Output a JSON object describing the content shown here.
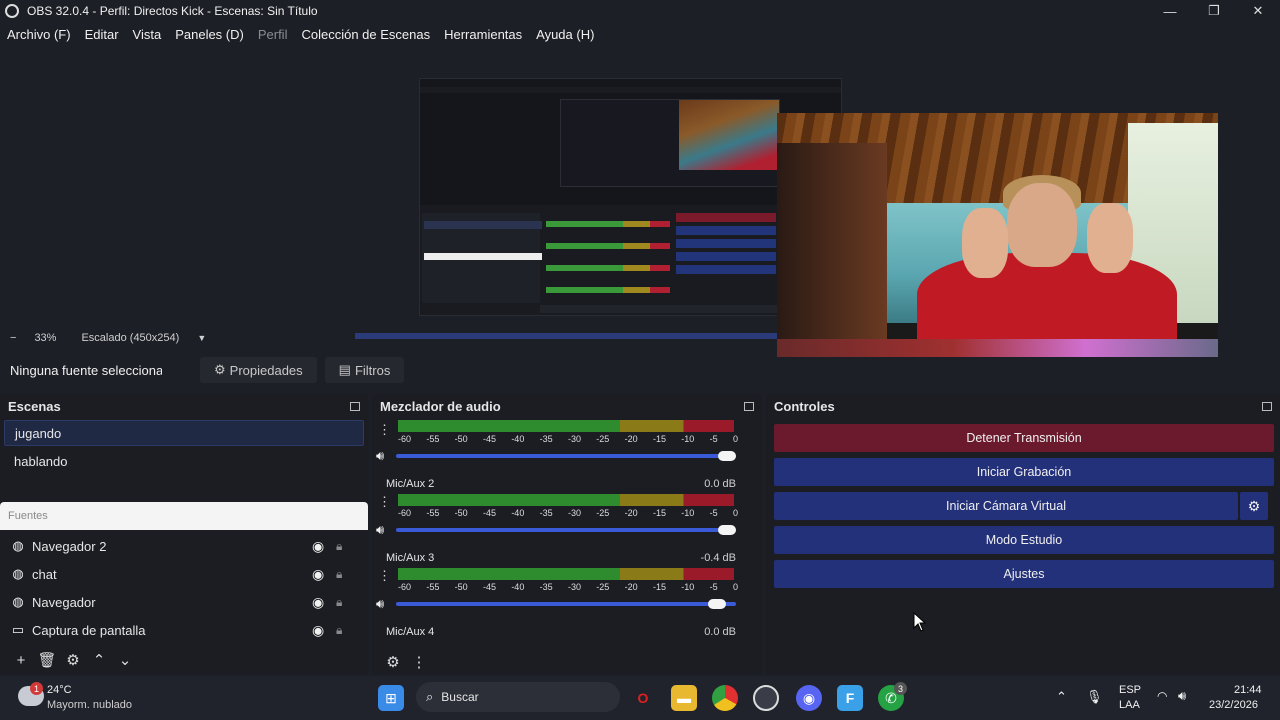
{
  "window": {
    "title": "OBS 32.0.4 - Perfil: Directos Kick - Escenas: Sin Título",
    "minimize_icon": "minimize-icon",
    "maximize_icon": "restore-icon",
    "close_icon": "close-icon"
  },
  "menu": {
    "items": [
      "Archivo (F)",
      "Editar",
      "Vista",
      "Paneles (D)",
      "Perfil",
      "Colección de Escenas",
      "Herramientas",
      "Ayuda (H)"
    ]
  },
  "stats": {
    "zoom_minus": "−",
    "zoom": "33%",
    "scaling": "Escalado (450x254)"
  },
  "source_toolbar": {
    "no_source": "Ninguna fuente seleccionada",
    "properties": "Propiedades",
    "filters": "Filtros"
  },
  "scenes": {
    "title": "Escenas",
    "items": [
      "jugando",
      "hablando"
    ],
    "active_index": 0
  },
  "sources": {
    "title": "Fuentes",
    "items": [
      {
        "name": "Navegador 2",
        "icon": "globe-icon"
      },
      {
        "name": "chat",
        "icon": "globe-icon"
      },
      {
        "name": "Navegador",
        "icon": "globe-icon"
      },
      {
        "name": "Captura de pantalla",
        "icon": "monitor-icon"
      }
    ]
  },
  "mixer": {
    "title": "Mezclador de audio",
    "tick_labels": [
      "-60",
      "-55",
      "-50",
      "-45",
      "-40",
      "-35",
      "-30",
      "-25",
      "-20",
      "-15",
      "-10",
      "-5",
      "0"
    ],
    "channels": [
      {
        "name": "",
        "db": "",
        "volume": 1.0
      },
      {
        "name": "Mic/Aux 2",
        "db": "0.0 dB",
        "volume": 1.0
      },
      {
        "name": "Mic/Aux 3",
        "db": "-0.4 dB",
        "volume": 0.97
      },
      {
        "name": "Mic/Aux 4",
        "db": "0.0 dB",
        "volume": 1.0
      }
    ]
  },
  "controls": {
    "title": "Controles",
    "buttons": [
      "Detener Transmisión",
      "Iniciar Grabación",
      "Iniciar Cámara Virtual",
      "Modo Estudio",
      "Ajustes"
    ]
  },
  "taskbar": {
    "weather_temp": "24°C",
    "weather_desc": "Mayorm. nublado",
    "weather_badge": "1",
    "search_placeholder": "Buscar",
    "lang_top": "ESP",
    "lang_bottom": "LAA",
    "time": "21:44",
    "date": "23/2/2026",
    "whatsapp_badge": "3"
  },
  "colors": {
    "stop_stream": "#6a1a2c",
    "control_blue": "#23307a",
    "panel_bg": "#1b1d23"
  }
}
